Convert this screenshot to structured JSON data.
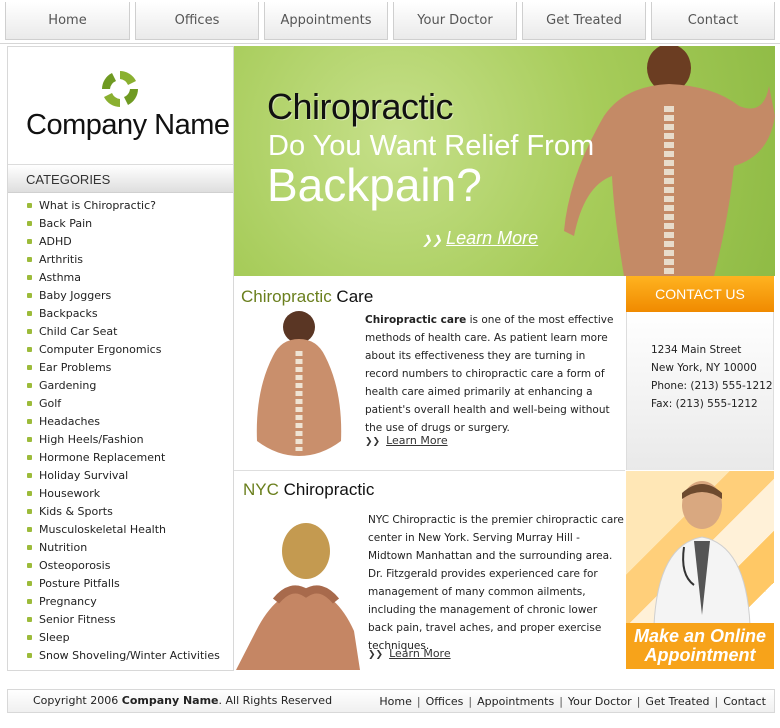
{
  "nav": {
    "tabs": [
      "Home",
      "Offices",
      "Appointments",
      "Your Doctor",
      "Get Treated",
      "Contact"
    ]
  },
  "sidebar": {
    "company_name": "Company Name",
    "categories_title": "CATEGORIES",
    "categories": [
      "What is Chiropractic?",
      "Back Pain",
      "ADHD",
      "Arthritis",
      "Asthma",
      "Baby Joggers",
      "Backpacks",
      "Child Car Seat",
      "Computer Ergonomics",
      "Ear Problems",
      "Gardening",
      "Golf",
      "Headaches",
      "High Heels/Fashion",
      "Hormone Replacement",
      "Holiday Survival",
      "Housework",
      "Kids & Sports",
      "Musculoskeletal Health",
      "Nutrition",
      "Osteoporosis",
      "Posture Pitfalls",
      "Pregnancy",
      "Senior Fitness",
      "Sleep",
      "Snow Shoveling/Winter Activities"
    ]
  },
  "hero": {
    "line1": "Chiropractic",
    "line2": "Do You  Want Relief From",
    "line3": "Backpain?",
    "learn_more": "Learn More"
  },
  "care": {
    "title_hl": "Chiropractic",
    "title_rest": " Care",
    "lead": "Chiropractic care",
    "body": " is one of the most effective methods of health care. As patient learn more about its effectiveness they are turning in record numbers to chiropractic care a form of health care aimed primarily at enhancing a patient's overall health and well-being without the use of drugs or surgery.",
    "learn_more": "Learn More"
  },
  "nyc": {
    "title_hl": "NYC",
    "title_rest": " Chiropractic",
    "body": "NYC Chiropractic is the premier chiropractic care center in New York. Serving Murray Hill - Midtown Manhattan and the surrounding area. Dr. Fitzgerald provides experienced care for management of many common ailments, including the management of chronic lower back pain, travel aches, and proper exercise techniques.",
    "learn_more": "Learn More"
  },
  "contact": {
    "title": "CONTACT US",
    "street": "1234 Main Street",
    "city": "New York, NY 10000",
    "phone": "Phone: (213) 555-1212",
    "fax": "Fax:  (213) 555-1212"
  },
  "appointment": {
    "line1": "Make an Online",
    "line2": "Appointment"
  },
  "footer": {
    "copyright_prefix": "Copyright 2006 ",
    "company": "Company Name",
    "copyright_suffix": ". All Rights Reserved",
    "links": [
      "Home",
      "Offices",
      "Appointments",
      "Your Doctor",
      "Get Treated",
      "Contact"
    ]
  },
  "colors": {
    "accent_green": "#9cbb3a",
    "accent_orange": "#f7a31a",
    "hero_green": "#a7cc5a"
  }
}
